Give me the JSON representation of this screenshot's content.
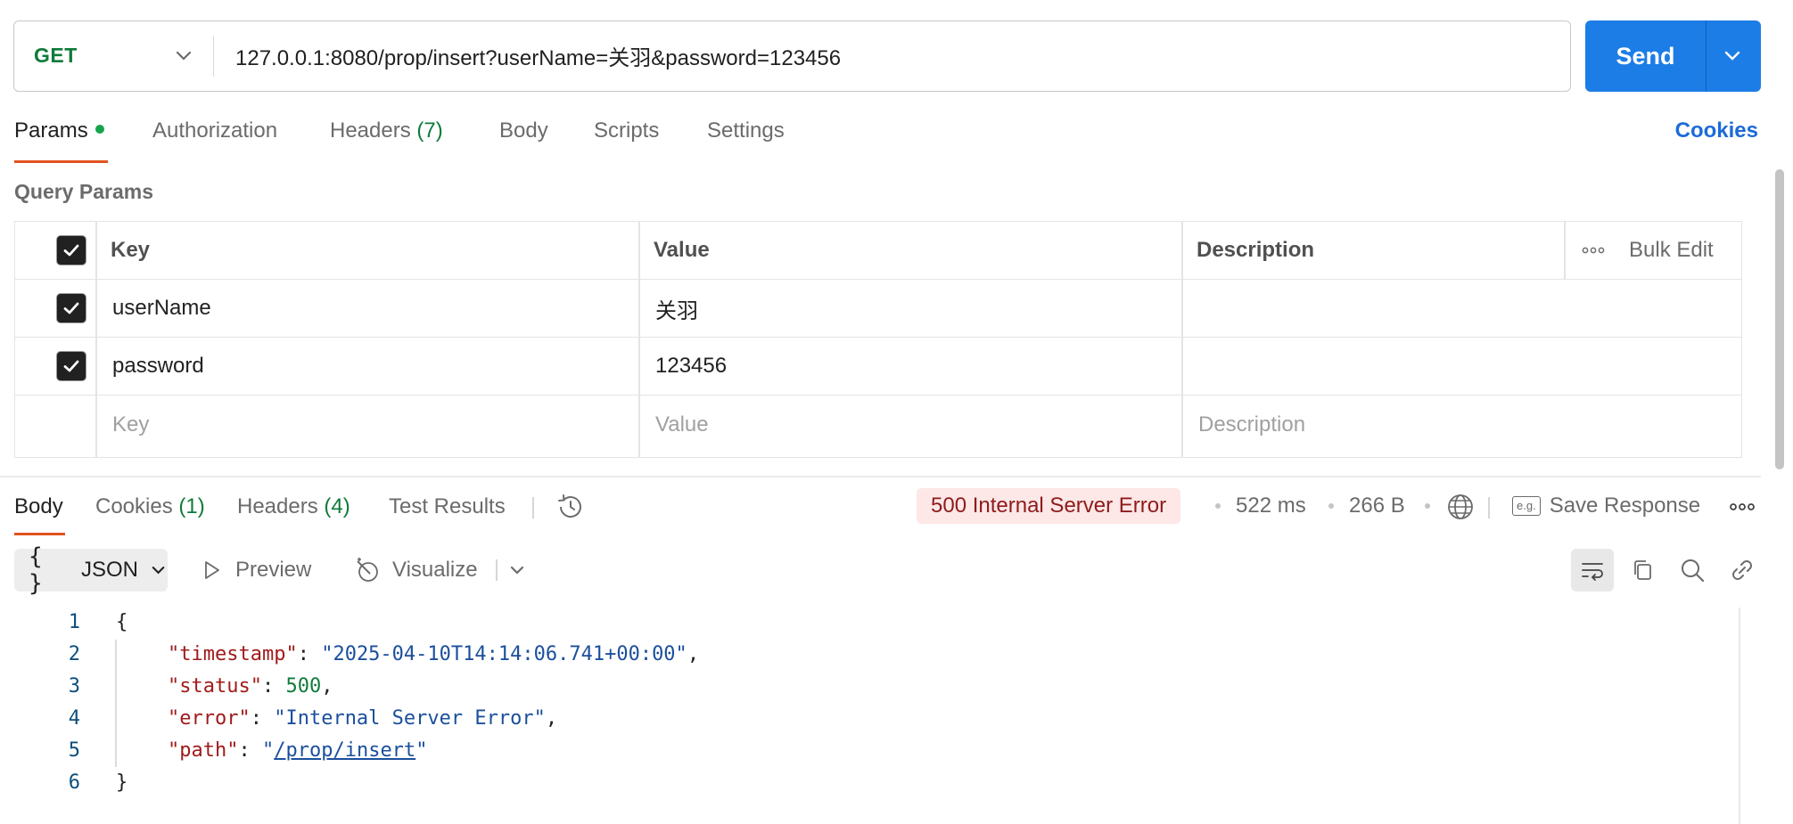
{
  "request": {
    "method": "GET",
    "url": "127.0.0.1:8080/prop/insert?userName=关羽&password=123456",
    "send_label": "Send"
  },
  "request_tabs": {
    "params": "Params",
    "authorization": "Authorization",
    "headers": "Headers",
    "headers_count": "(7)",
    "body": "Body",
    "scripts": "Scripts",
    "settings": "Settings",
    "cookies": "Cookies"
  },
  "query_params": {
    "title": "Query Params",
    "headers": {
      "key": "Key",
      "value": "Value",
      "description": "Description",
      "bulk_edit": "Bulk Edit"
    },
    "rows": [
      {
        "checked": true,
        "key": "userName",
        "value": "关羽",
        "description": ""
      },
      {
        "checked": true,
        "key": "password",
        "value": "123456",
        "description": ""
      }
    ],
    "placeholders": {
      "key": "Key",
      "value": "Value",
      "description": "Description"
    }
  },
  "response_tabs": {
    "body": "Body",
    "cookies": "Cookies",
    "cookies_count": "(1)",
    "headers": "Headers",
    "headers_count": "(4)",
    "test_results": "Test Results"
  },
  "response_meta": {
    "status": "500 Internal Server Error",
    "time": "522 ms",
    "size": "266 B",
    "save_response": "Save Response",
    "eg_label": "e.g."
  },
  "body_toolbar": {
    "format": "JSON",
    "preview": "Preview",
    "visualize": "Visualize"
  },
  "code": {
    "line_numbers": [
      "1",
      "2",
      "3",
      "4",
      "5",
      "6"
    ],
    "open_brace": "{",
    "close_brace": "}",
    "timestamp_key": "\"timestamp\"",
    "timestamp_value": "\"2025-04-10T14:14:06.741+00:00\"",
    "status_key": "\"status\"",
    "status_value": "500",
    "error_key": "\"error\"",
    "error_value": "\"Internal Server Error\"",
    "path_key": "\"path\"",
    "path_value": "/prop/insert"
  },
  "colors": {
    "send": "#1c7de6",
    "method": "#0f7b3a",
    "active_tab": "#e0531f",
    "status_bg": "#fde7e7",
    "status_text": "#8e1b1b",
    "cookies_link": "#1c6bd8"
  }
}
